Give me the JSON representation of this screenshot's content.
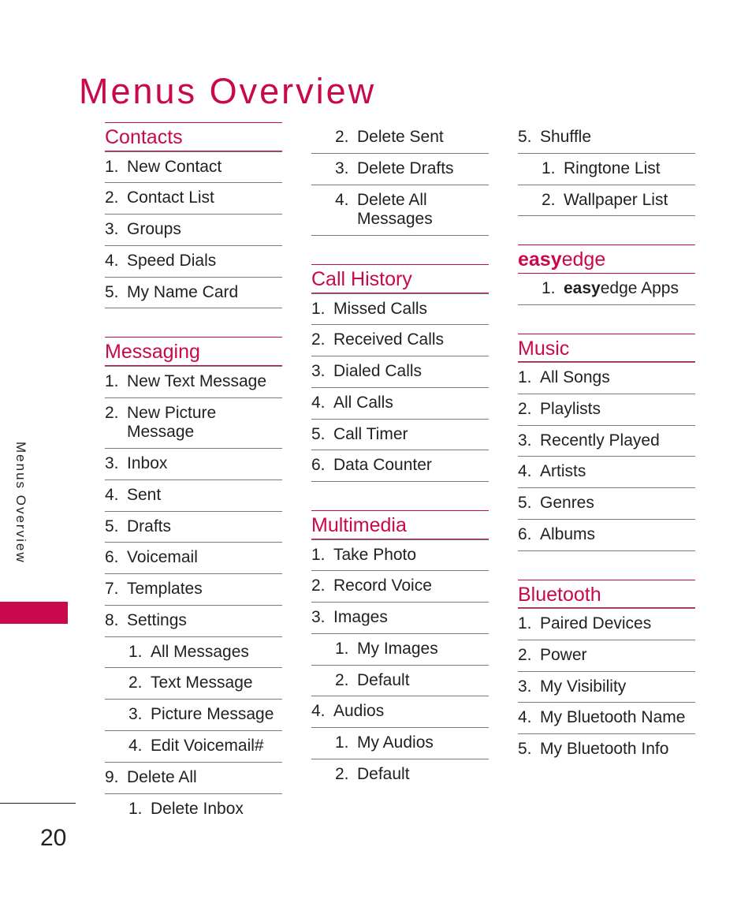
{
  "page": {
    "title": "Menus Overview",
    "running_head": "Menus Overview",
    "folio": "20",
    "accent_color": "#c8094e",
    "rule_color": "#7b7b7b",
    "text_color": "#231f20"
  },
  "columns": [
    {
      "blocks": [
        {
          "type": "section",
          "heading": "Contacts",
          "heading_bold_prefix": "",
          "first_item_has_rule": true,
          "closing_rule": true,
          "items": [
            {
              "num": "1.",
              "label": "New Contact",
              "level": 1
            },
            {
              "num": "2.",
              "label": "Contact List",
              "level": 1
            },
            {
              "num": "3.",
              "label": "Groups",
              "level": 1
            },
            {
              "num": "4.",
              "label": "Speed Dials",
              "level": 1
            },
            {
              "num": "5.",
              "label": "My Name Card",
              "level": 1
            }
          ]
        },
        {
          "type": "section",
          "heading": "Messaging",
          "heading_bold_prefix": "",
          "first_item_has_rule": true,
          "closing_rule": false,
          "items": [
            {
              "num": "1.",
              "label": "New Text Message",
              "level": 1
            },
            {
              "num": "2.",
              "label": "New Picture Message",
              "level": 1
            },
            {
              "num": "3.",
              "label": "Inbox",
              "level": 1
            },
            {
              "num": "4.",
              "label": "Sent",
              "level": 1
            },
            {
              "num": "5.",
              "label": "Drafts",
              "level": 1
            },
            {
              "num": "6.",
              "label": "Voicemail",
              "level": 1
            },
            {
              "num": "7.",
              "label": "Templates",
              "level": 1
            },
            {
              "num": "8.",
              "label": "Settings",
              "level": 1
            },
            {
              "num": "1.",
              "label": "All Messages",
              "level": 2
            },
            {
              "num": "2.",
              "label": "Text Message",
              "level": 2
            },
            {
              "num": "3.",
              "label": "Picture Message",
              "level": 2
            },
            {
              "num": "4.",
              "label": "Edit Voicemail#",
              "level": 2
            },
            {
              "num": "9.",
              "label": "Delete All",
              "level": 1
            },
            {
              "num": "1.",
              "label": "Delete Inbox",
              "level": 2
            }
          ]
        }
      ]
    },
    {
      "blocks": [
        {
          "type": "continuation",
          "heading": "",
          "first_item_has_rule": false,
          "closing_rule": true,
          "items": [
            {
              "num": "2.",
              "label": "Delete Sent",
              "level": 2
            },
            {
              "num": "3.",
              "label": "Delete Drafts",
              "level": 2
            },
            {
              "num": "4.",
              "label": "Delete All Messages",
              "level": 2
            }
          ]
        },
        {
          "type": "section",
          "heading": "Call History",
          "heading_bold_prefix": "",
          "first_item_has_rule": true,
          "closing_rule": true,
          "items": [
            {
              "num": "1.",
              "label": "Missed Calls",
              "level": 1
            },
            {
              "num": "2.",
              "label": "Received Calls",
              "level": 1
            },
            {
              "num": "3.",
              "label": "Dialed Calls",
              "level": 1
            },
            {
              "num": "4.",
              "label": "All Calls",
              "level": 1
            },
            {
              "num": "5.",
              "label": "Call Timer",
              "level": 1
            },
            {
              "num": "6.",
              "label": "Data Counter",
              "level": 1
            }
          ]
        },
        {
          "type": "section",
          "heading": "Multimedia",
          "heading_bold_prefix": "",
          "first_item_has_rule": true,
          "closing_rule": false,
          "items": [
            {
              "num": "1.",
              "label": "Take Photo",
              "level": 1
            },
            {
              "num": "2.",
              "label": "Record Voice",
              "level": 1
            },
            {
              "num": "3.",
              "label": "Images",
              "level": 1
            },
            {
              "num": "1.",
              "label": "My Images",
              "level": 2
            },
            {
              "num": "2.",
              "label": "Default",
              "level": 2
            },
            {
              "num": "4.",
              "label": "Audios",
              "level": 1
            },
            {
              "num": "1.",
              "label": "My Audios",
              "level": 2
            },
            {
              "num": "2.",
              "label": "Default",
              "level": 2
            }
          ]
        }
      ]
    },
    {
      "blocks": [
        {
          "type": "continuation",
          "heading": "",
          "first_item_has_rule": false,
          "closing_rule": true,
          "items": [
            {
              "num": "5.",
              "label": "Shuffle",
              "level": 1
            },
            {
              "num": "1.",
              "label": "Ringtone List",
              "level": 2
            },
            {
              "num": "2.",
              "label": "Wallpaper List",
              "level": 2
            }
          ]
        },
        {
          "type": "section",
          "heading": "easyedge",
          "heading_bold_prefix": "easy",
          "first_item_has_rule": false,
          "closing_rule": true,
          "items": [
            {
              "num": "1.",
              "label": "easyedge Apps",
              "bold_prefix": "easy",
              "level": 2
            }
          ]
        },
        {
          "type": "section",
          "heading": "Music",
          "heading_bold_prefix": "",
          "first_item_has_rule": true,
          "closing_rule": true,
          "items": [
            {
              "num": "1.",
              "label": "All Songs",
              "level": 1
            },
            {
              "num": "2.",
              "label": "Playlists",
              "level": 1
            },
            {
              "num": "3.",
              "label": "Recently Played",
              "level": 1
            },
            {
              "num": "4.",
              "label": "Artists",
              "level": 1
            },
            {
              "num": "5.",
              "label": "Genres",
              "level": 1
            },
            {
              "num": "6.",
              "label": "Albums",
              "level": 1
            }
          ]
        },
        {
          "type": "section",
          "heading": "Bluetooth",
          "heading_bold_prefix": "",
          "first_item_has_rule": true,
          "closing_rule": false,
          "items": [
            {
              "num": "1.",
              "label": "Paired Devices",
              "level": 1
            },
            {
              "num": "2.",
              "label": "Power",
              "level": 1
            },
            {
              "num": "3.",
              "label": "My Visibility",
              "level": 1
            },
            {
              "num": "4.",
              "label": "My Bluetooth Name",
              "level": 1
            },
            {
              "num": "5.",
              "label": "My Bluetooth Info",
              "level": 1
            }
          ]
        }
      ]
    }
  ]
}
